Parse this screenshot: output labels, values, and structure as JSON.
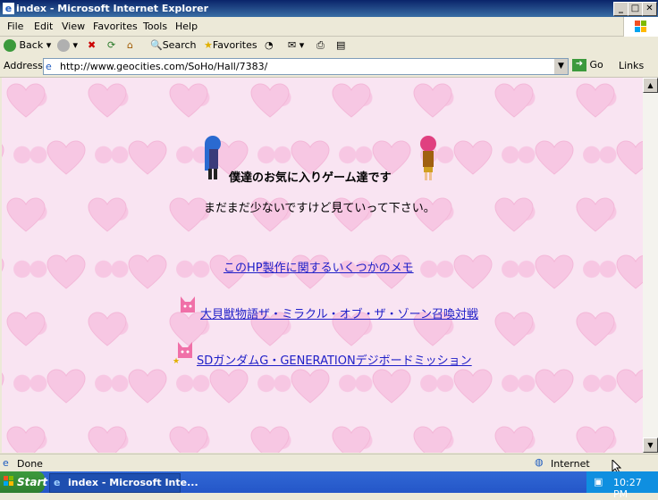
{
  "window": {
    "title": "index - Microsoft Internet Explorer"
  },
  "menu": [
    "File",
    "Edit",
    "View",
    "Favorites",
    "Tools",
    "Help"
  ],
  "toolbar": {
    "back": "Back",
    "search": "Search",
    "favorites": "Favorites"
  },
  "address": {
    "label": "Address",
    "url": "http://www.geocities.com/SoHo/Hall/7383/",
    "go": "Go",
    "links": "Links"
  },
  "page": {
    "title": "僕達のお気に入りゲーム達です",
    "subtitle": "まだまだ少ないですけど見ていって下さい。",
    "links": [
      "このHP製作に関するいくつかのメモ",
      "大貝獣物語ザ・ミラクル・オブ・ザ・ゾーン召喚対戦",
      "SDガンダムG・GENERATIONデジボードミッション"
    ]
  },
  "status": {
    "text": "Done",
    "zone": "Internet"
  },
  "taskbar": {
    "start": "Start",
    "task": "index - Microsoft Inte...",
    "clock": "10:27 PM"
  },
  "colors": {
    "link": "#2020c8",
    "heart": "#f7c7e3",
    "page_bg": "#f9e4f2"
  }
}
